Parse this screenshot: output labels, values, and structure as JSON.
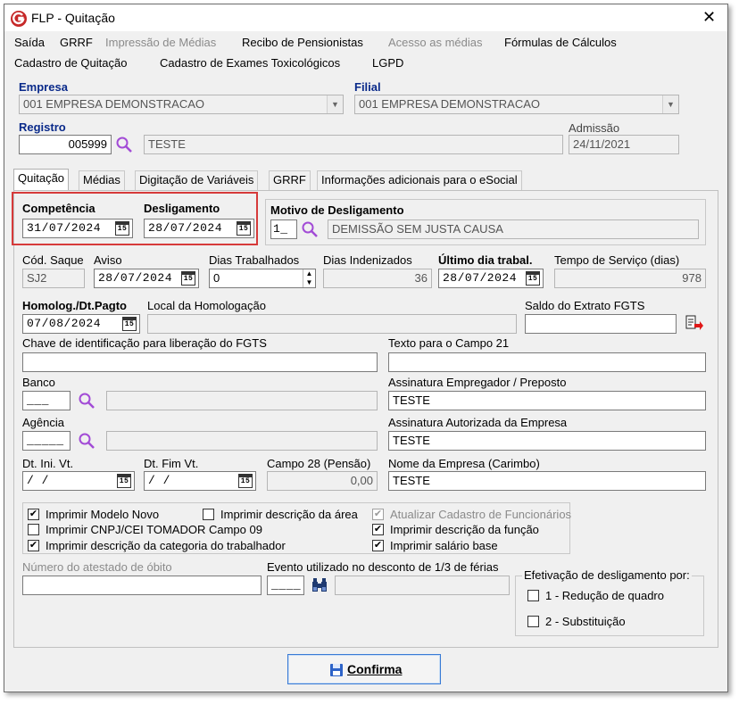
{
  "window": {
    "title": "FLP - Quitação"
  },
  "menu": {
    "row1": [
      "Saída",
      "GRRF",
      "Impressão de Médias",
      "Recibo de Pensionistas",
      "Acesso as médias",
      "Fórmulas de Cálculos"
    ],
    "row2": [
      "Cadastro de Quitação",
      "Cadastro de Exames Toxicológicos",
      "LGPD"
    ]
  },
  "empresa": {
    "label": "Empresa",
    "value": "001 EMPRESA DEMONSTRACAO"
  },
  "filial": {
    "label": "Filial",
    "value": "001 EMPRESA DEMONSTRACAO"
  },
  "registro": {
    "label": "Registro",
    "value": "005999",
    "name": "TESTE"
  },
  "admissao": {
    "label": "Admissão",
    "value": "24/11/2021"
  },
  "tabs": [
    "Quitação",
    "Médias",
    "Digitação de Variáveis",
    "GRRF",
    "Informações adicionais para o eSocial"
  ],
  "competencia": {
    "label": "Competência",
    "value": "31/07/2024"
  },
  "desligamento": {
    "label": "Desligamento",
    "value": "28/07/2024"
  },
  "motivo": {
    "label": "Motivo de Desligamento",
    "code": "1_",
    "value": "DEMISSÃO SEM JUSTA CAUSA"
  },
  "cod_saque": {
    "label": "Cód. Saque",
    "value": "SJ2"
  },
  "aviso": {
    "label": "Aviso",
    "value": "28/07/2024"
  },
  "dias_trabalhados": {
    "label": "Dias Trabalhados",
    "value": "0"
  },
  "dias_indenizados": {
    "label": "Dias Indenizados",
    "value": "36"
  },
  "ultimo_dia": {
    "label": "Último dia trabal.",
    "value": "28/07/2024"
  },
  "tempo_servico": {
    "label": "Tempo de Serviço (dias)",
    "value": "978"
  },
  "homolog": {
    "label": "Homolog./Dt.Pagto",
    "value": "07/08/2024"
  },
  "local_homolog": {
    "label": "Local da Homologação",
    "value": ""
  },
  "saldo_fgts": {
    "label": "Saldo do Extrato FGTS",
    "value": ""
  },
  "chave_fgts": {
    "label": "Chave de identificação para liberação do FGTS",
    "value": ""
  },
  "texto_campo21": {
    "label": "Texto para o Campo 21",
    "value": ""
  },
  "banco": {
    "label": "Banco",
    "value": "___",
    "name": ""
  },
  "assinatura_empregador": {
    "label": "Assinatura Empregador / Preposto",
    "value": "TESTE"
  },
  "agencia": {
    "label": "Agência",
    "value": "_____",
    "name": ""
  },
  "assinatura_autorizada": {
    "label": "Assinatura Autorizada da Empresa",
    "value": "TESTE"
  },
  "dt_ini_vt": {
    "label": "Dt. Ini. Vt.",
    "value": " / /"
  },
  "dt_fim_vt": {
    "label": "Dt. Fim Vt.",
    "value": " / /"
  },
  "campo28": {
    "label": "Campo 28 (Pensão)",
    "value": "0,00"
  },
  "nome_empresa": {
    "label": "Nome da Empresa (Carimbo)",
    "value": "TESTE"
  },
  "checkboxes": [
    {
      "label": "Imprimir Modelo Novo",
      "checked": true,
      "enabled": true
    },
    {
      "label": "Imprimir descrição da área",
      "checked": false,
      "enabled": true
    },
    {
      "label": "Atualizar Cadastro de Funcionários",
      "checked": true,
      "enabled": false
    },
    {
      "label": "Imprimir CNPJ/CEI TOMADOR Campo 09",
      "checked": false,
      "enabled": true
    },
    {
      "label": "Imprimir descrição da função",
      "checked": true,
      "enabled": true
    },
    {
      "label": "Imprimir descrição da categoria do trabalhador",
      "checked": true,
      "enabled": true
    },
    {
      "label": "Imprimir salário base",
      "checked": true,
      "enabled": true
    }
  ],
  "atestado_obito": {
    "label": "Número do atestado de óbito",
    "value": ""
  },
  "evento_ferias": {
    "label": "Evento utilizado no desconto de 1/3 de férias",
    "value": "____"
  },
  "efetivacao": {
    "label": "Efetivação de desligamento por:",
    "options": [
      {
        "label": "1 - Redução de quadro",
        "checked": false
      },
      {
        "label": "2 - Substituição",
        "checked": false
      }
    ]
  },
  "confirma": {
    "label": "Confirma"
  },
  "icons": {
    "calendar": "15",
    "spin_up": "▲",
    "spin_down": "▼",
    "combo": "▼",
    "check": "✔",
    "close": "✕"
  },
  "colors": {
    "highlight_border": "#d63a3a",
    "label_blue": "#0a2a8a",
    "app_icon": "#c62828"
  }
}
